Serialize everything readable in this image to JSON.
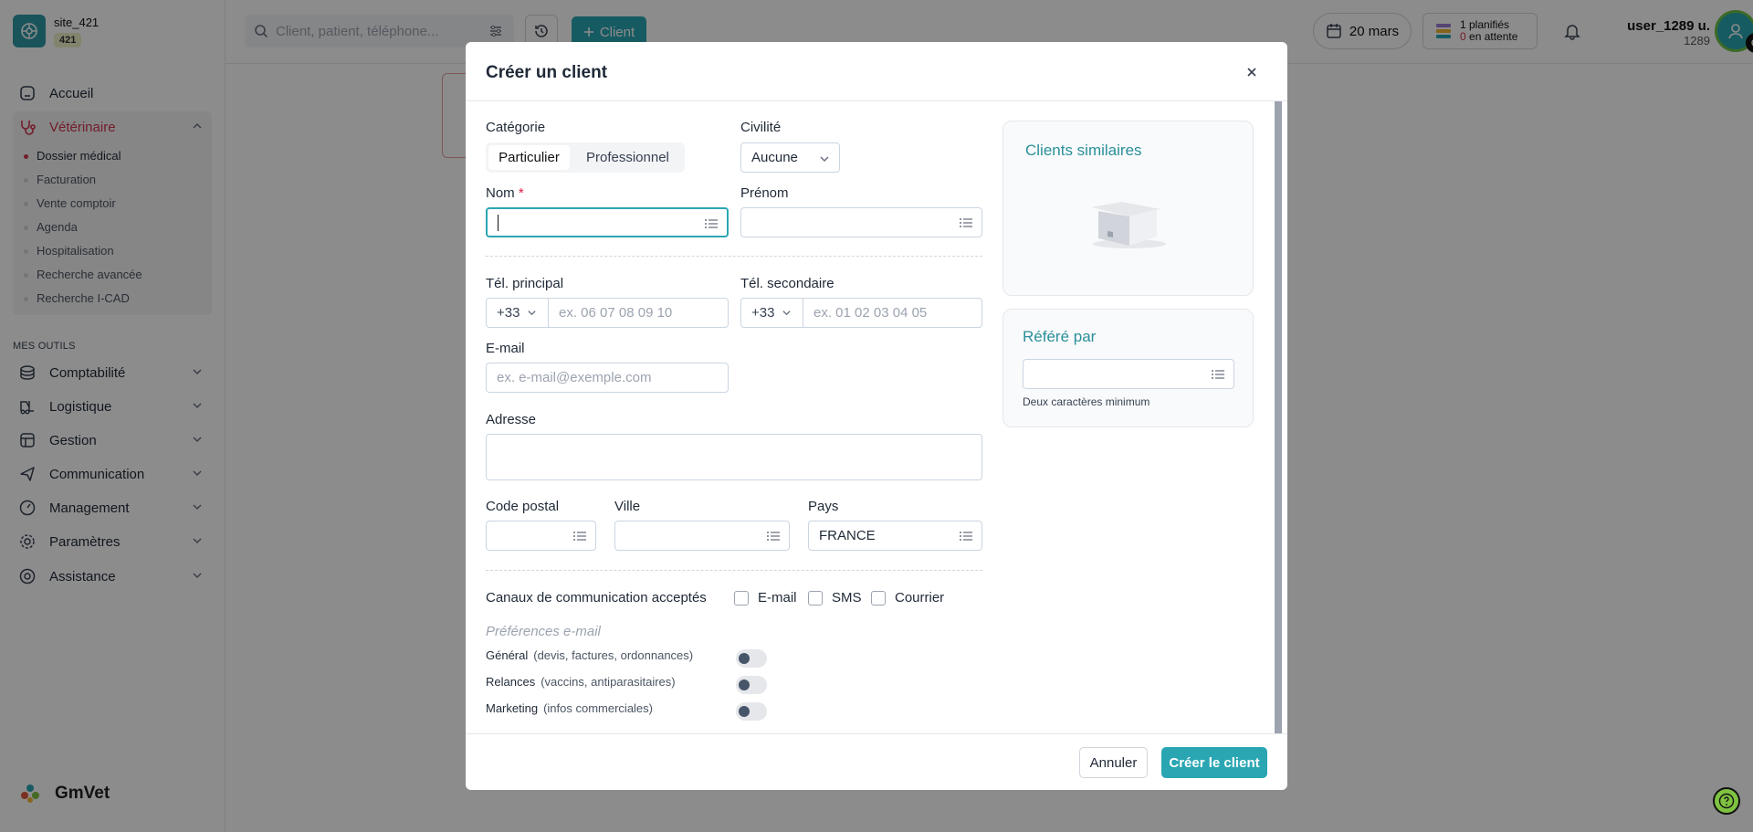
{
  "site": {
    "name": "site_421",
    "badge": "421"
  },
  "sidebar": {
    "items": [
      {
        "label": "Accueil",
        "icon": "home-icon"
      },
      {
        "label": "Vétérinaire",
        "icon": "stethoscope-icon"
      }
    ],
    "vet_sub": [
      "Dossier médical",
      "Facturation",
      "Vente comptoir",
      "Agenda",
      "Hospitalisation",
      "Recherche avancée",
      "Recherche I-CAD"
    ],
    "tools_heading": "MES OUTILS",
    "tools": [
      {
        "label": "Comptabilité",
        "icon": "coins-icon"
      },
      {
        "label": "Logistique",
        "icon": "forklift-icon"
      },
      {
        "label": "Gestion",
        "icon": "table-icon"
      },
      {
        "label": "Communication",
        "icon": "send-icon"
      },
      {
        "label": "Management",
        "icon": "gauge-icon"
      },
      {
        "label": "Paramètres",
        "icon": "gear-icon"
      },
      {
        "label": "Assistance",
        "icon": "lifebuoy-icon"
      }
    ],
    "brand": "GmVet"
  },
  "topbar": {
    "search_placeholder": "Client, patient, téléphone...",
    "client_button": "Client",
    "date": "20 mars",
    "planned": "1 planifiés",
    "pending_count": "0",
    "pending_label": "en attente",
    "user_name": "user_1289 u.",
    "user_id": "1289"
  },
  "modal": {
    "title": "Créer un client",
    "categorie_label": "Catégorie",
    "cat_particulier": "Particulier",
    "cat_professionnel": "Professionnel",
    "civilite_label": "Civilité",
    "civilite_value": "Aucune",
    "nom_label": "Nom",
    "nom_required": "*",
    "prenom_label": "Prénom",
    "tel_principal_label": "Tél. principal",
    "tel_principal_code": "+33",
    "tel_principal_placeholder": "ex. 06 07 08 09 10",
    "tel_secondaire_label": "Tél. secondaire",
    "tel_secondaire_code": "+33",
    "tel_secondaire_placeholder": "ex. 01 02 03 04 05",
    "email_label": "E-mail",
    "email_placeholder": "ex. e-mail@exemple.com",
    "adresse_label": "Adresse",
    "code_postal_label": "Code postal",
    "ville_label": "Ville",
    "pays_label": "Pays",
    "pays_value": "FRANCE",
    "canaux_label": "Canaux de communication acceptés",
    "canal_email": "E-mail",
    "canal_sms": "SMS",
    "canal_courrier": "Courrier",
    "preferences_title": "Préférences e-mail",
    "preferences": [
      {
        "label": "Général",
        "detail": "(devis, factures, ordonnances)"
      },
      {
        "label": "Relances",
        "detail": "(vaccins, antiparasitaires)"
      },
      {
        "label": "Marketing",
        "detail": "(infos commerciales)"
      }
    ],
    "similar_title": "Clients similaires",
    "refere_title": "Référé par",
    "refere_hint": "Deux caractères minimum",
    "cancel": "Annuler",
    "create": "Créer le client"
  },
  "colors": {
    "accent": "#2aa6b3",
    "vet_red": "#d2344f",
    "panel_title": "#2a8f9a"
  }
}
